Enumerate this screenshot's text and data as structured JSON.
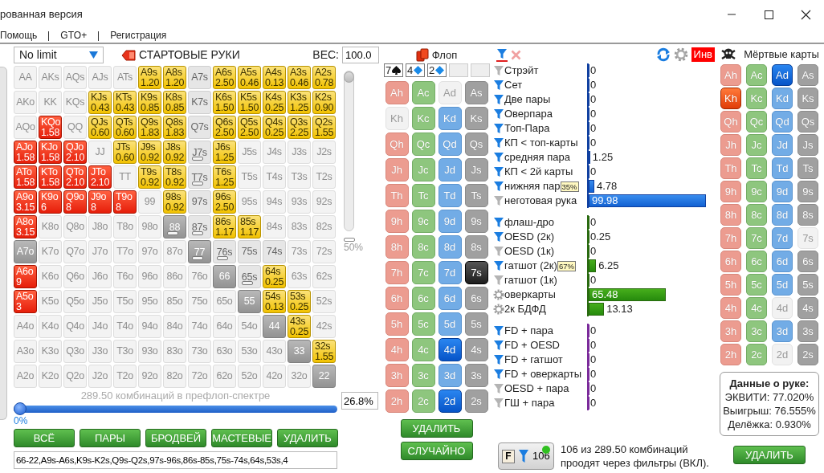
{
  "window": {
    "title": "рованная версия"
  },
  "menu": [
    "Помощь",
    "GTO+",
    "Регистрация"
  ],
  "game_select": {
    "value": "No limit"
  },
  "range_title": "СТАРТОВЫЕ РУКИ",
  "weight": {
    "label": "ВЕС:",
    "value": "100.0"
  },
  "hands": [
    [
      {
        "hand": "AA",
        "kind": "empty",
        "marked": false
      },
      {
        "hand": "AKs",
        "kind": "empty",
        "marked": false
      },
      {
        "hand": "AQs",
        "kind": "empty",
        "marked": false
      },
      {
        "hand": "AJs",
        "kind": "empty",
        "marked": false
      },
      {
        "hand": "ATs",
        "kind": "empty",
        "marked": false
      },
      {
        "hand": "A9s",
        "kind": "suited",
        "weight": "1.20",
        "marked": false
      },
      {
        "hand": "A8s",
        "kind": "suited",
        "weight": "1.20",
        "marked": false
      },
      {
        "hand": "A7s",
        "kind": "dim",
        "marked": false
      },
      {
        "hand": "A6s",
        "kind": "suited",
        "weight": "2.50",
        "marked": false
      },
      {
        "hand": "A5s",
        "kind": "suited",
        "weight": "0.46",
        "marked": false
      },
      {
        "hand": "A4s",
        "kind": "suited",
        "weight": "0.13",
        "marked": false
      },
      {
        "hand": "A3s",
        "kind": "suited",
        "weight": "0.46",
        "marked": false
      },
      {
        "hand": "A2s",
        "kind": "suited",
        "weight": "0.78",
        "marked": false
      }
    ],
    [
      {
        "hand": "AKo",
        "kind": "empty",
        "marked": false
      },
      {
        "hand": "KK",
        "kind": "empty",
        "marked": false
      },
      {
        "hand": "KQs",
        "kind": "empty",
        "marked": false
      },
      {
        "hand": "KJs",
        "kind": "suited",
        "weight": "0.43",
        "marked": false
      },
      {
        "hand": "KTs",
        "kind": "suited",
        "weight": "0.43",
        "marked": false
      },
      {
        "hand": "K9s",
        "kind": "suited",
        "weight": "0.85",
        "marked": false
      },
      {
        "hand": "K8s",
        "kind": "suited",
        "weight": "0.85",
        "marked": false
      },
      {
        "hand": "K7s",
        "kind": "dim",
        "marked": false
      },
      {
        "hand": "K6s",
        "kind": "suited",
        "weight": "1.50",
        "marked": false
      },
      {
        "hand": "K5s",
        "kind": "suited",
        "weight": "1.50",
        "marked": false
      },
      {
        "hand": "K4s",
        "kind": "suited",
        "weight": "0.25",
        "marked": false
      },
      {
        "hand": "K3s",
        "kind": "suited",
        "weight": "1.25",
        "marked": false
      },
      {
        "hand": "K2s",
        "kind": "suited",
        "weight": "0.90",
        "marked": false
      }
    ],
    [
      {
        "hand": "AQo",
        "kind": "empty",
        "marked": false
      },
      {
        "hand": "KQo",
        "kind": "offsuit",
        "weight": "1.58",
        "marked": false
      },
      {
        "hand": "QQ",
        "kind": "empty",
        "marked": false
      },
      {
        "hand": "QJs",
        "kind": "suited",
        "weight": "0.60",
        "marked": false
      },
      {
        "hand": "QTs",
        "kind": "suited",
        "weight": "0.60",
        "marked": false
      },
      {
        "hand": "Q9s",
        "kind": "suited",
        "weight": "1.83",
        "marked": false
      },
      {
        "hand": "Q8s",
        "kind": "suited",
        "weight": "1.83",
        "marked": false
      },
      {
        "hand": "Q7s",
        "kind": "dim",
        "marked": false
      },
      {
        "hand": "Q6s",
        "kind": "suited",
        "weight": "2.50",
        "marked": false
      },
      {
        "hand": "Q5s",
        "kind": "suited",
        "weight": "2.50",
        "marked": false
      },
      {
        "hand": "Q4s",
        "kind": "suited",
        "weight": "0.25",
        "marked": false
      },
      {
        "hand": "Q3s",
        "kind": "suited",
        "weight": "2.25",
        "marked": false
      },
      {
        "hand": "Q2s",
        "kind": "suited",
        "weight": "1.55",
        "marked": false
      }
    ],
    [
      {
        "hand": "AJo",
        "kind": "offsuit",
        "weight": "1.58",
        "marked": false
      },
      {
        "hand": "KJo",
        "kind": "offsuit",
        "weight": "1.58",
        "marked": false
      },
      {
        "hand": "QJo",
        "kind": "offsuit",
        "weight": "2.10",
        "marked": false
      },
      {
        "hand": "JJ",
        "kind": "empty",
        "marked": false
      },
      {
        "hand": "JTs",
        "kind": "suited",
        "weight": "0.60",
        "marked": false
      },
      {
        "hand": "J9s",
        "kind": "suited",
        "weight": "0.92",
        "marked": false
      },
      {
        "hand": "J8s",
        "kind": "suited",
        "weight": "0.92",
        "marked": false
      },
      {
        "hand": "J7s",
        "kind": "dim",
        "marked": true
      },
      {
        "hand": "J6s",
        "kind": "suited",
        "weight": "1.25",
        "marked": false
      },
      {
        "hand": "J5s",
        "kind": "empty",
        "marked": false
      },
      {
        "hand": "J4s",
        "kind": "empty",
        "marked": false
      },
      {
        "hand": "J3s",
        "kind": "empty",
        "marked": false
      },
      {
        "hand": "J2s",
        "kind": "empty",
        "marked": false
      }
    ],
    [
      {
        "hand": "ATo",
        "kind": "offsuit",
        "weight": "1.58",
        "marked": false
      },
      {
        "hand": "KTo",
        "kind": "offsuit",
        "weight": "1.58",
        "marked": false
      },
      {
        "hand": "QTo",
        "kind": "offsuit",
        "weight": "2.10",
        "marked": false
      },
      {
        "hand": "JTo",
        "kind": "offsuit",
        "weight": "2.10",
        "marked": false
      },
      {
        "hand": "TT",
        "kind": "empty",
        "marked": false
      },
      {
        "hand": "T9s",
        "kind": "suited",
        "weight": "0.92",
        "marked": false
      },
      {
        "hand": "T8s",
        "kind": "suited",
        "weight": "0.92",
        "marked": false
      },
      {
        "hand": "T7s",
        "kind": "dim",
        "marked": true
      },
      {
        "hand": "T6s",
        "kind": "suited",
        "weight": "1.25",
        "marked": false
      },
      {
        "hand": "T5s",
        "kind": "empty",
        "marked": false
      },
      {
        "hand": "T4s",
        "kind": "empty",
        "marked": false
      },
      {
        "hand": "T3s",
        "kind": "empty",
        "marked": false
      },
      {
        "hand": "T2s",
        "kind": "empty",
        "marked": false
      }
    ],
    [
      {
        "hand": "A9o",
        "kind": "offsuit",
        "weight": "3.15",
        "marked": false
      },
      {
        "hand": "K9o",
        "kind": "offsuit",
        "weight": "6",
        "marked": false
      },
      {
        "hand": "Q9o",
        "kind": "offsuit",
        "weight": "8",
        "marked": false
      },
      {
        "hand": "J9o",
        "kind": "offsuit",
        "weight": "8",
        "marked": false
      },
      {
        "hand": "T9o",
        "kind": "offsuit",
        "weight": "8",
        "marked": false
      },
      {
        "hand": "99",
        "kind": "empty",
        "marked": false
      },
      {
        "hand": "98s",
        "kind": "suited",
        "weight": "0.92",
        "marked": false
      },
      {
        "hand": "97s",
        "kind": "dim",
        "marked": false
      },
      {
        "hand": "96s",
        "kind": "suited",
        "weight": "2.50",
        "marked": false
      },
      {
        "hand": "95s",
        "kind": "empty",
        "marked": false
      },
      {
        "hand": "94s",
        "kind": "empty",
        "marked": false
      },
      {
        "hand": "93s",
        "kind": "empty",
        "marked": false
      },
      {
        "hand": "92s",
        "kind": "empty",
        "marked": false
      }
    ],
    [
      {
        "hand": "A8o",
        "kind": "offsuit",
        "weight": "3.15",
        "marked": false
      },
      {
        "hand": "K8o",
        "kind": "empty",
        "marked": false
      },
      {
        "hand": "Q8o",
        "kind": "empty",
        "marked": false
      },
      {
        "hand": "J8o",
        "kind": "empty",
        "marked": false
      },
      {
        "hand": "T8o",
        "kind": "empty",
        "marked": false
      },
      {
        "hand": "98o",
        "kind": "empty",
        "marked": false
      },
      {
        "hand": "88",
        "kind": "grey",
        "marked": true
      },
      {
        "hand": "87s",
        "kind": "dim",
        "marked": true
      },
      {
        "hand": "86s",
        "kind": "suited",
        "weight": "1.17",
        "marked": false
      },
      {
        "hand": "85s",
        "kind": "suited",
        "weight": "1.17",
        "marked": false
      },
      {
        "hand": "84s",
        "kind": "empty",
        "marked": false
      },
      {
        "hand": "83s",
        "kind": "empty",
        "marked": false
      },
      {
        "hand": "82s",
        "kind": "empty",
        "marked": false
      }
    ],
    [
      {
        "hand": "A7o",
        "kind": "grey",
        "marked": false
      },
      {
        "hand": "K7o",
        "kind": "empty",
        "marked": false
      },
      {
        "hand": "Q7o",
        "kind": "empty",
        "marked": false
      },
      {
        "hand": "J7o",
        "kind": "empty",
        "marked": false
      },
      {
        "hand": "T7o",
        "kind": "empty",
        "marked": false
      },
      {
        "hand": "97o",
        "kind": "empty",
        "marked": false
      },
      {
        "hand": "87o",
        "kind": "empty",
        "marked": false
      },
      {
        "hand": "77",
        "kind": "grey",
        "marked": true
      },
      {
        "hand": "76s",
        "kind": "dim",
        "marked": true
      },
      {
        "hand": "75s",
        "kind": "dim",
        "marked": false
      },
      {
        "hand": "74s",
        "kind": "dim",
        "marked": false
      },
      {
        "hand": "73s",
        "kind": "empty",
        "marked": false
      },
      {
        "hand": "72s",
        "kind": "empty",
        "marked": false
      }
    ],
    [
      {
        "hand": "A6o",
        "kind": "offsuit",
        "weight": "9",
        "marked": false
      },
      {
        "hand": "K6o",
        "kind": "empty",
        "marked": false
      },
      {
        "hand": "Q6o",
        "kind": "empty",
        "marked": false
      },
      {
        "hand": "J6o",
        "kind": "empty",
        "marked": false
      },
      {
        "hand": "T6o",
        "kind": "empty",
        "marked": false
      },
      {
        "hand": "96o",
        "kind": "empty",
        "marked": false
      },
      {
        "hand": "86o",
        "kind": "empty",
        "marked": false
      },
      {
        "hand": "76o",
        "kind": "empty",
        "marked": false
      },
      {
        "hand": "66",
        "kind": "grey",
        "marked": false
      },
      {
        "hand": "65s",
        "kind": "dim",
        "marked": true
      },
      {
        "hand": "64s",
        "kind": "suited",
        "weight": "0.25",
        "marked": false
      },
      {
        "hand": "63s",
        "kind": "empty",
        "marked": false
      },
      {
        "hand": "62s",
        "kind": "empty",
        "marked": false
      }
    ],
    [
      {
        "hand": "A5o",
        "kind": "offsuit",
        "weight": "3",
        "marked": false
      },
      {
        "hand": "K5o",
        "kind": "empty",
        "marked": false
      },
      {
        "hand": "Q5o",
        "kind": "empty",
        "marked": false
      },
      {
        "hand": "J5o",
        "kind": "empty",
        "marked": false
      },
      {
        "hand": "T5o",
        "kind": "empty",
        "marked": false
      },
      {
        "hand": "95o",
        "kind": "empty",
        "marked": false
      },
      {
        "hand": "85o",
        "kind": "empty",
        "marked": false
      },
      {
        "hand": "75o",
        "kind": "empty",
        "marked": false
      },
      {
        "hand": "65o",
        "kind": "empty",
        "marked": false
      },
      {
        "hand": "55",
        "kind": "grey",
        "marked": false
      },
      {
        "hand": "54s",
        "kind": "suited",
        "weight": "0.13",
        "marked": false
      },
      {
        "hand": "53s",
        "kind": "suited",
        "weight": "0.25",
        "marked": false
      },
      {
        "hand": "52s",
        "kind": "empty",
        "marked": false
      }
    ],
    [
      {
        "hand": "A4o",
        "kind": "empty",
        "marked": false
      },
      {
        "hand": "K4o",
        "kind": "empty",
        "marked": false
      },
      {
        "hand": "Q4o",
        "kind": "empty",
        "marked": false
      },
      {
        "hand": "J4o",
        "kind": "empty",
        "marked": false
      },
      {
        "hand": "T4o",
        "kind": "empty",
        "marked": false
      },
      {
        "hand": "94o",
        "kind": "empty",
        "marked": false
      },
      {
        "hand": "84o",
        "kind": "empty",
        "marked": false
      },
      {
        "hand": "74o",
        "kind": "empty",
        "marked": false
      },
      {
        "hand": "64o",
        "kind": "empty",
        "marked": false
      },
      {
        "hand": "54o",
        "kind": "empty",
        "marked": false
      },
      {
        "hand": "44",
        "kind": "grey",
        "marked": false
      },
      {
        "hand": "43s",
        "kind": "suited",
        "weight": "0.25",
        "marked": false
      },
      {
        "hand": "42s",
        "kind": "empty",
        "marked": false
      }
    ],
    [
      {
        "hand": "A3o",
        "kind": "empty",
        "marked": false
      },
      {
        "hand": "K3o",
        "kind": "empty",
        "marked": false
      },
      {
        "hand": "Q3o",
        "kind": "empty",
        "marked": false
      },
      {
        "hand": "J3o",
        "kind": "empty",
        "marked": false
      },
      {
        "hand": "T3o",
        "kind": "empty",
        "marked": false
      },
      {
        "hand": "93o",
        "kind": "empty",
        "marked": false
      },
      {
        "hand": "83o",
        "kind": "empty",
        "marked": false
      },
      {
        "hand": "73o",
        "kind": "empty",
        "marked": false
      },
      {
        "hand": "63o",
        "kind": "empty",
        "marked": false
      },
      {
        "hand": "53o",
        "kind": "empty",
        "marked": false
      },
      {
        "hand": "43o",
        "kind": "empty",
        "marked": false
      },
      {
        "hand": "33",
        "kind": "grey",
        "marked": false
      },
      {
        "hand": "32s",
        "kind": "suited",
        "weight": "1.55",
        "marked": false
      }
    ],
    [
      {
        "hand": "A2o",
        "kind": "empty",
        "marked": false
      },
      {
        "hand": "K2o",
        "kind": "empty",
        "marked": false
      },
      {
        "hand": "Q2o",
        "kind": "empty",
        "marked": false
      },
      {
        "hand": "J2o",
        "kind": "empty",
        "marked": false
      },
      {
        "hand": "T2o",
        "kind": "empty",
        "marked": false
      },
      {
        "hand": "92o",
        "kind": "empty",
        "marked": false
      },
      {
        "hand": "82o",
        "kind": "empty",
        "marked": false
      },
      {
        "hand": "72o",
        "kind": "empty",
        "marked": false
      },
      {
        "hand": "62o",
        "kind": "empty",
        "marked": false
      },
      {
        "hand": "52o",
        "kind": "empty",
        "marked": false
      },
      {
        "hand": "42o",
        "kind": "empty",
        "marked": false
      },
      {
        "hand": "32o",
        "kind": "empty",
        "marked": false
      },
      {
        "hand": "22",
        "kind": "grey",
        "marked": false
      }
    ]
  ],
  "weight_slider": {
    "level": 1,
    "label": "50%"
  },
  "combos_caption": "289.50 комбинаций в префлоп-спектре",
  "range_slider": {
    "level": 0,
    "min_label": "0%",
    "value": "26.8%"
  },
  "range_buttons": [
    "ВСЁ",
    "ПАРЫ",
    "БРОДВЕЙ",
    "МАСТЕВЫЕ",
    "УДАЛИТЬ"
  ],
  "range_text": "66-22,A9s-A6s,K9s-K2s,Q9s-Q2s,97s-96s,86s-85s,75s-74s,64s,53s,4",
  "flop": {
    "title": "Флоп",
    "board": [
      {
        "rank": "7",
        "kind": "spades"
      },
      {
        "rank": "4",
        "kind": "diamonds"
      },
      {
        "rank": "2",
        "kind": "diamonds"
      }
    ],
    "cards": [
      [
        {
          "label": "Ah",
          "selected": false,
          "disabled": false
        },
        {
          "label": "Ac",
          "selected": false,
          "disabled": false
        },
        {
          "label": "Ad",
          "selected": false,
          "disabled": true
        },
        {
          "label": "As",
          "selected": false,
          "disabled": false
        }
      ],
      [
        {
          "label": "Kh",
          "selected": false,
          "disabled": true
        },
        {
          "label": "Kc",
          "selected": false,
          "disabled": false
        },
        {
          "label": "Kd",
          "selected": false,
          "disabled": false
        },
        {
          "label": "Ks",
          "selected": false,
          "disabled": false
        }
      ],
      [
        {
          "label": "Qh",
          "selected": false,
          "disabled": false
        },
        {
          "label": "Qc",
          "selected": false,
          "disabled": false
        },
        {
          "label": "Qd",
          "selected": false,
          "disabled": false
        },
        {
          "label": "Qs",
          "selected": false,
          "disabled": false
        }
      ],
      [
        {
          "label": "Jh",
          "selected": false,
          "disabled": false
        },
        {
          "label": "Jc",
          "selected": false,
          "disabled": false
        },
        {
          "label": "Jd",
          "selected": false,
          "disabled": false
        },
        {
          "label": "Js",
          "selected": false,
          "disabled": false
        }
      ],
      [
        {
          "label": "Th",
          "selected": false,
          "disabled": false
        },
        {
          "label": "Tc",
          "selected": false,
          "disabled": false
        },
        {
          "label": "Td",
          "selected": false,
          "disabled": false
        },
        {
          "label": "Ts",
          "selected": false,
          "disabled": false
        }
      ],
      [
        {
          "label": "9h",
          "selected": false,
          "disabled": false
        },
        {
          "label": "9c",
          "selected": false,
          "disabled": false
        },
        {
          "label": "9d",
          "selected": false,
          "disabled": false
        },
        {
          "label": "9s",
          "selected": false,
          "disabled": false
        }
      ],
      [
        {
          "label": "8h",
          "selected": false,
          "disabled": false
        },
        {
          "label": "8c",
          "selected": false,
          "disabled": false
        },
        {
          "label": "8d",
          "selected": false,
          "disabled": false
        },
        {
          "label": "8s",
          "selected": false,
          "disabled": false
        }
      ],
      [
        {
          "label": "7h",
          "selected": false,
          "disabled": false
        },
        {
          "label": "7c",
          "selected": false,
          "disabled": false
        },
        {
          "label": "7d",
          "selected": false,
          "disabled": false
        },
        {
          "label": "7s",
          "selected": true,
          "disabled": false
        }
      ],
      [
        {
          "label": "6h",
          "selected": false,
          "disabled": false
        },
        {
          "label": "6c",
          "selected": false,
          "disabled": false
        },
        {
          "label": "6d",
          "selected": false,
          "disabled": false
        },
        {
          "label": "6s",
          "selected": false,
          "disabled": false
        }
      ],
      [
        {
          "label": "5h",
          "selected": false,
          "disabled": false
        },
        {
          "label": "5c",
          "selected": false,
          "disabled": false
        },
        {
          "label": "5d",
          "selected": false,
          "disabled": false
        },
        {
          "label": "5s",
          "selected": false,
          "disabled": false
        }
      ],
      [
        {
          "label": "4h",
          "selected": false,
          "disabled": false
        },
        {
          "label": "4c",
          "selected": false,
          "disabled": false
        },
        {
          "label": "4d",
          "selected": true,
          "disabled": false
        },
        {
          "label": "4s",
          "selected": false,
          "disabled": false
        }
      ],
      [
        {
          "label": "3h",
          "selected": false,
          "disabled": false
        },
        {
          "label": "3c",
          "selected": false,
          "disabled": false
        },
        {
          "label": "3d",
          "selected": false,
          "disabled": false
        },
        {
          "label": "3s",
          "selected": false,
          "disabled": false
        }
      ],
      [
        {
          "label": "2h",
          "selected": false,
          "disabled": false
        },
        {
          "label": "2c",
          "selected": false,
          "disabled": false
        },
        {
          "label": "2d",
          "selected": true,
          "disabled": false
        },
        {
          "label": "2s",
          "selected": false,
          "disabled": false
        }
      ]
    ],
    "buttons": [
      "УДАЛИТЬ",
      "СЛУЧАЙНО"
    ]
  },
  "filters": {
    "invert_label": "Инв",
    "groups": [
      {
        "kind": "made",
        "items": [
          {
            "label": "Стрэйт",
            "kind": "off",
            "value": "0",
            "level": 0
          },
          {
            "label": "Сет",
            "kind": "on",
            "value": "0",
            "level": 0
          },
          {
            "label": "Две пары",
            "kind": "on",
            "value": "0",
            "level": 0
          },
          {
            "label": "Оверпара",
            "kind": "on",
            "value": "0",
            "level": 0
          },
          {
            "label": "Топ-Пара",
            "kind": "on",
            "value": "0",
            "level": 0
          },
          {
            "label": "КП < топ-карты",
            "kind": "on",
            "value": "0",
            "level": 0
          },
          {
            "label": "средняя пара",
            "kind": "on",
            "value": "1.25",
            "level": 0.0125
          },
          {
            "label": "КП < 2й карты",
            "kind": "on",
            "value": "0",
            "level": 0
          },
          {
            "label": "нижняя пар",
            "kind": "on",
            "badge": "35%",
            "value": "4.78",
            "level": 0.0478
          },
          {
            "label": "неготовая рука",
            "kind": "off",
            "value": "99.98",
            "level": 0.9998
          }
        ]
      },
      {
        "kind": "draw",
        "items": [
          {
            "label": "флаш-дро",
            "kind": "on",
            "value": "0",
            "level": 0
          },
          {
            "label": "OESD (2к)",
            "kind": "on",
            "value": "0.25",
            "level": 0.0025
          },
          {
            "label": "OESD (1к)",
            "kind": "off",
            "value": "0",
            "level": 0
          },
          {
            "label": "гатшот (2к)",
            "kind": "on",
            "badge": "67%",
            "value": "6.25",
            "level": 0.0625
          },
          {
            "label": "гатшот (1к)",
            "kind": "off",
            "value": "0",
            "level": 0
          },
          {
            "label": "оверкарты",
            "kind": "gear",
            "value": "65.48",
            "level": 0.6548
          },
          {
            "label": "2к БДФД",
            "kind": "gear",
            "value": "13.13",
            "level": 0.1313
          }
        ]
      },
      {
        "kind": "combo",
        "items": [
          {
            "label": "FD + пара",
            "kind": "on",
            "value": "0",
            "level": 0
          },
          {
            "label": "FD + OESD",
            "kind": "on",
            "value": "0",
            "level": 0
          },
          {
            "label": "FD + гатшот",
            "kind": "on",
            "value": "0",
            "level": 0
          },
          {
            "label": "FD + оверкарты",
            "kind": "on",
            "value": "0",
            "level": 0
          },
          {
            "label": "OESD + пара",
            "kind": "off",
            "value": "0",
            "level": 0
          },
          {
            "label": "ГШ + пара",
            "kind": "off",
            "value": "0",
            "level": 0
          }
        ]
      }
    ]
  },
  "filter_summary": {
    "letter": "F",
    "count": "106",
    "active": true,
    "lines": [
      "106 из 289.50 комбинаций",
      "проодят через фильтры (ВКЛ)."
    ]
  },
  "dead_cards": {
    "title": "Мёртвые карты",
    "cards": [
      [
        {
          "label": "Ah",
          "selected": false,
          "disabled": false
        },
        {
          "label": "Ac",
          "selected": false,
          "disabled": false
        },
        {
          "label": "Ad",
          "selected": true,
          "disabled": false
        },
        {
          "label": "As",
          "selected": false,
          "disabled": false
        }
      ],
      [
        {
          "label": "Kh",
          "selected": true,
          "disabled": false
        },
        {
          "label": "Kc",
          "selected": false,
          "disabled": false
        },
        {
          "label": "Kd",
          "selected": false,
          "disabled": false
        },
        {
          "label": "Ks",
          "selected": false,
          "disabled": false
        }
      ],
      [
        {
          "label": "Qh",
          "selected": false,
          "disabled": false
        },
        {
          "label": "Qc",
          "selected": false,
          "disabled": false
        },
        {
          "label": "Qd",
          "selected": false,
          "disabled": false
        },
        {
          "label": "Qs",
          "selected": false,
          "disabled": false
        }
      ],
      [
        {
          "label": "Jh",
          "selected": false,
          "disabled": false
        },
        {
          "label": "Jc",
          "selected": false,
          "disabled": false
        },
        {
          "label": "Jd",
          "selected": false,
          "disabled": false
        },
        {
          "label": "Js",
          "selected": false,
          "disabled": false
        }
      ],
      [
        {
          "label": "Th",
          "selected": false,
          "disabled": false
        },
        {
          "label": "Tc",
          "selected": false,
          "disabled": false
        },
        {
          "label": "Td",
          "selected": false,
          "disabled": false
        },
        {
          "label": "Ts",
          "selected": false,
          "disabled": false
        }
      ],
      [
        {
          "label": "9h",
          "selected": false,
          "disabled": false
        },
        {
          "label": "9c",
          "selected": false,
          "disabled": false
        },
        {
          "label": "9d",
          "selected": false,
          "disabled": false
        },
        {
          "label": "9s",
          "selected": false,
          "disabled": false
        }
      ],
      [
        {
          "label": "8h",
          "selected": false,
          "disabled": false
        },
        {
          "label": "8c",
          "selected": false,
          "disabled": false
        },
        {
          "label": "8d",
          "selected": false,
          "disabled": false
        },
        {
          "label": "8s",
          "selected": false,
          "disabled": false
        }
      ],
      [
        {
          "label": "7h",
          "selected": false,
          "disabled": false
        },
        {
          "label": "7c",
          "selected": false,
          "disabled": false
        },
        {
          "label": "7d",
          "selected": false,
          "disabled": false
        },
        {
          "label": "7s",
          "selected": false,
          "disabled": true
        }
      ],
      [
        {
          "label": "6h",
          "selected": false,
          "disabled": false
        },
        {
          "label": "6c",
          "selected": false,
          "disabled": false
        },
        {
          "label": "6d",
          "selected": false,
          "disabled": false
        },
        {
          "label": "6s",
          "selected": false,
          "disabled": false
        }
      ],
      [
        {
          "label": "5h",
          "selected": false,
          "disabled": false
        },
        {
          "label": "5c",
          "selected": false,
          "disabled": false
        },
        {
          "label": "5d",
          "selected": false,
          "disabled": false
        },
        {
          "label": "5s",
          "selected": false,
          "disabled": false
        }
      ],
      [
        {
          "label": "4h",
          "selected": false,
          "disabled": false
        },
        {
          "label": "4c",
          "selected": false,
          "disabled": false
        },
        {
          "label": "4d",
          "selected": false,
          "disabled": true
        },
        {
          "label": "4s",
          "selected": false,
          "disabled": false
        }
      ],
      [
        {
          "label": "3h",
          "selected": false,
          "disabled": false
        },
        {
          "label": "3c",
          "selected": false,
          "disabled": false
        },
        {
          "label": "3d",
          "selected": false,
          "disabled": false
        },
        {
          "label": "3s",
          "selected": false,
          "disabled": false
        }
      ],
      [
        {
          "label": "2h",
          "selected": false,
          "disabled": false
        },
        {
          "label": "2c",
          "selected": false,
          "disabled": false
        },
        {
          "label": "2d",
          "selected": false,
          "disabled": true
        },
        {
          "label": "2s",
          "selected": false,
          "disabled": false
        }
      ]
    ]
  },
  "hand_info": {
    "title": "Данные о руке:",
    "lines": [
      "ЭКВИТИ: 77.020%",
      "Выигрыш: 76.555%",
      "Делёжка: 0.930%"
    ]
  },
  "dead_button": "УДАЛИТЬ"
}
